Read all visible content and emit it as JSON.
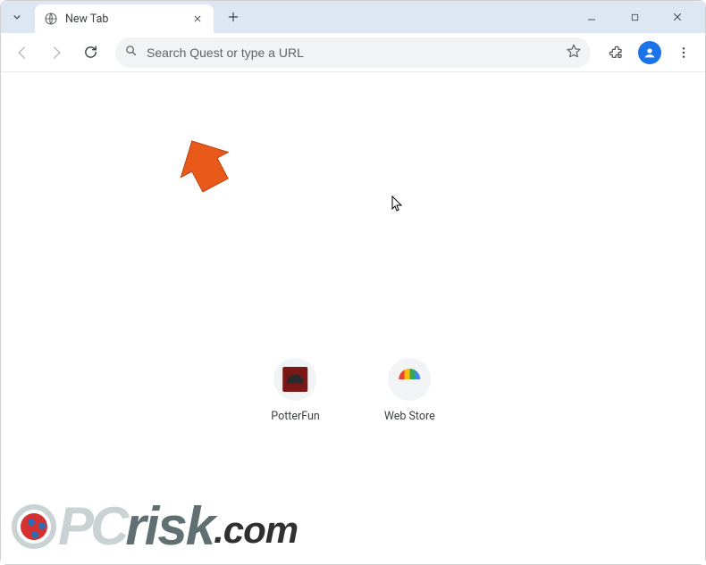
{
  "window": {
    "tab_title": "New Tab"
  },
  "toolbar": {
    "address_placeholder": "Search Quest or type a URL"
  },
  "shortcuts": [
    {
      "label": "PotterFun"
    },
    {
      "label": "Web Store"
    }
  ],
  "watermark": {
    "p": "PC",
    "risk": "risk",
    "com": ".com"
  }
}
